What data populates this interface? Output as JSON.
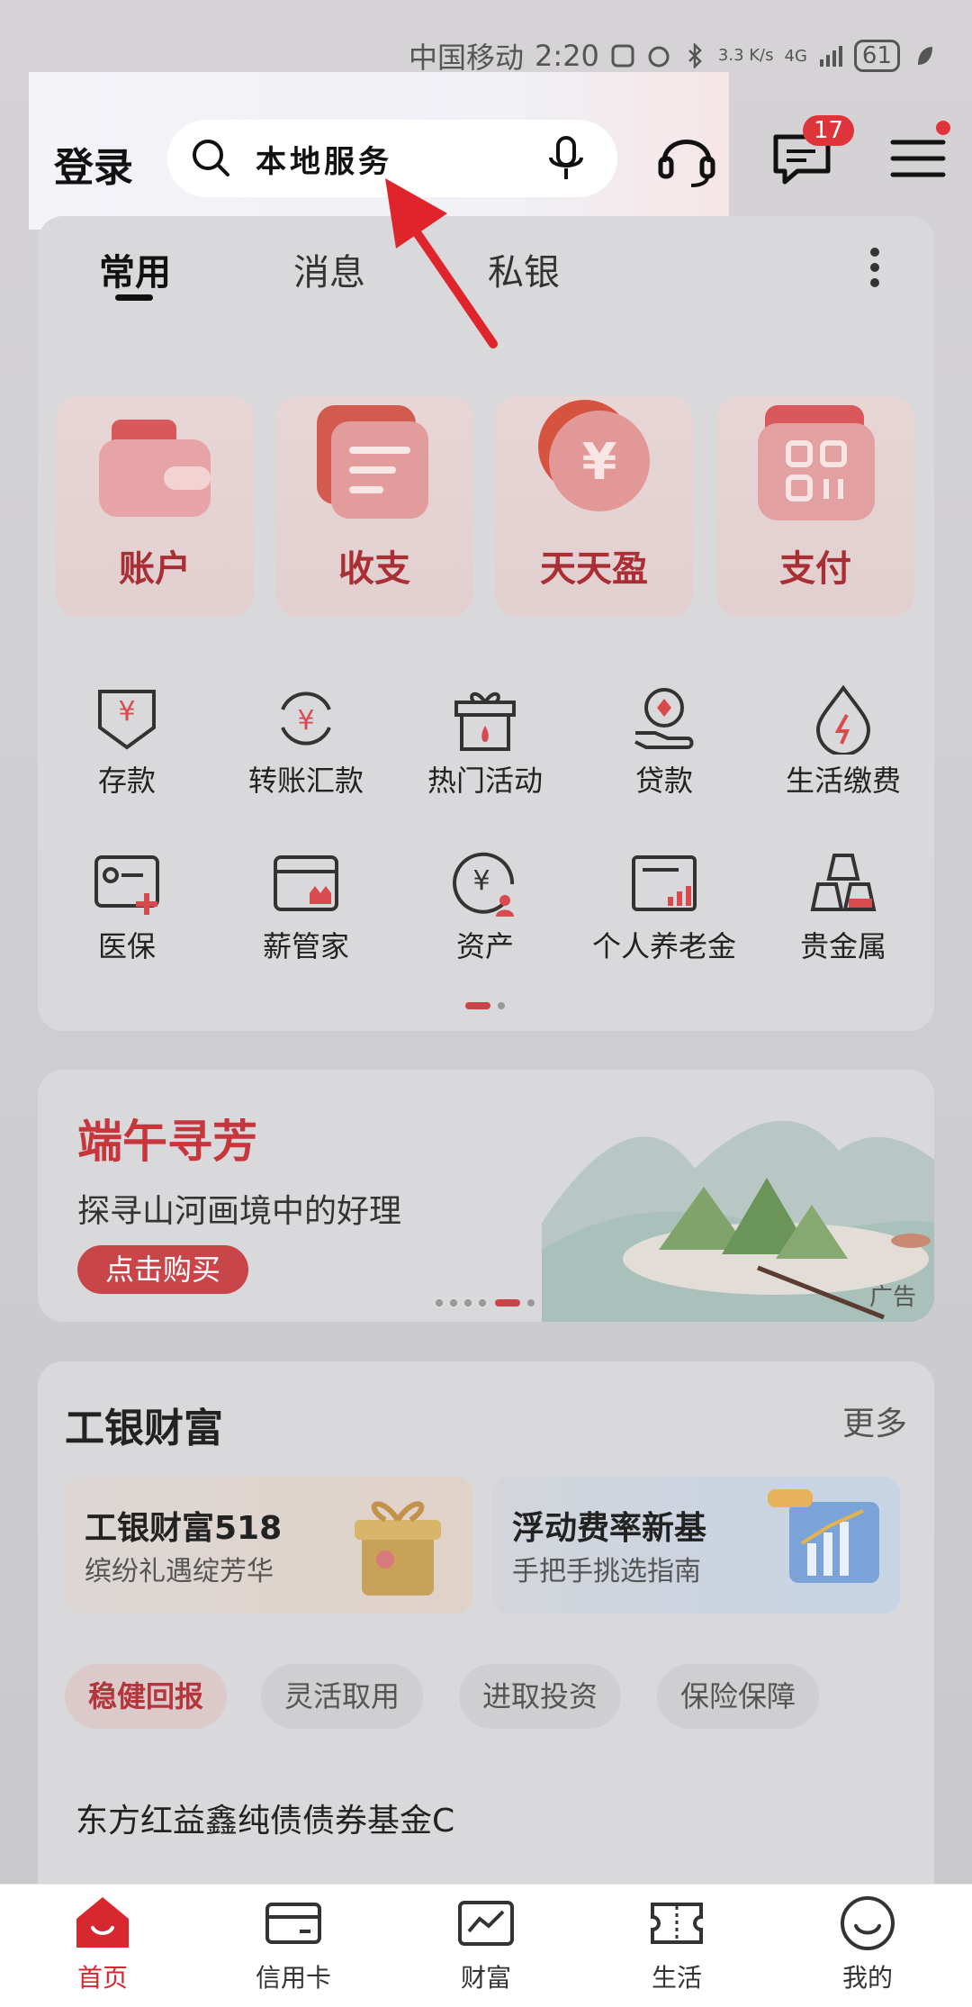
{
  "status_bar": {
    "carrier": "中国移动",
    "time": "2:20",
    "net_speed": "3.3\nK/s",
    "network": "4G",
    "battery": "61"
  },
  "header": {
    "login_label": "登录",
    "search_text": "本地服务",
    "message_badge": "17"
  },
  "tabs": [
    "常用",
    "消息",
    "私银"
  ],
  "tiles": [
    "账户",
    "收支",
    "天天盈",
    "支付"
  ],
  "grid": [
    {
      "label": "存款",
      "icon": "deposit-icon"
    },
    {
      "label": "转账汇款",
      "icon": "transfer-icon"
    },
    {
      "label": "热门活动",
      "icon": "gift-icon"
    },
    {
      "label": "贷款",
      "icon": "loan-icon"
    },
    {
      "label": "生活缴费",
      "icon": "bill-icon"
    },
    {
      "label": "医保",
      "icon": "medical-icon"
    },
    {
      "label": "薪管家",
      "icon": "salary-icon"
    },
    {
      "label": "资产",
      "icon": "asset-icon"
    },
    {
      "label": "个人养老金",
      "icon": "pension-icon"
    },
    {
      "label": "贵金属",
      "icon": "gold-icon"
    }
  ],
  "banner": {
    "title": "端午寻芳",
    "subtitle": "探寻山河画境中的好理",
    "button": "点击购买",
    "ad_tag": "广告"
  },
  "wealth": {
    "title": "工银财富",
    "more": "更多",
    "promos": [
      {
        "title": "工银财富518",
        "subtitle": "缤纷礼遇绽芳华"
      },
      {
        "title": "浮动费率新基",
        "subtitle": "手把手挑选指南"
      }
    ],
    "chips": [
      "稳健回报",
      "灵活取用",
      "进取投资",
      "保险保障"
    ],
    "fund_name": "东方红益鑫纯债债券基金C"
  },
  "bottom_nav": [
    "首页",
    "信用卡",
    "财富",
    "生活",
    "我的"
  ],
  "colors": {
    "accent_red": "#d8282f",
    "tile_text": "#a92f35"
  }
}
